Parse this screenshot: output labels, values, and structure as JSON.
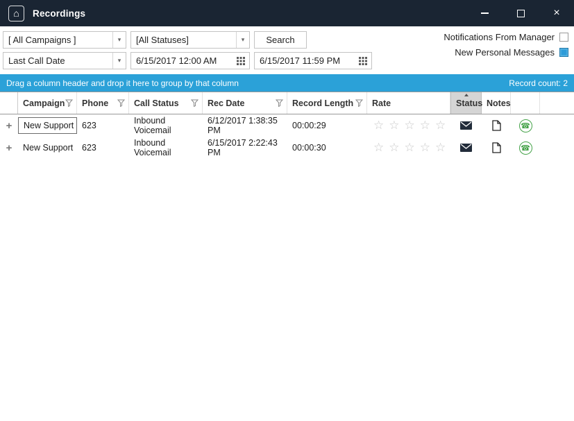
{
  "titlebar": {
    "title": "Recordings"
  },
  "toolbar": {
    "campaigns_dropdown": "[ All Campaigns ]",
    "statuses_dropdown": "[All Statuses]",
    "search_button": "Search",
    "sort_dropdown": "Last Call Date",
    "date_from": "6/15/2017 12:00 AM",
    "date_to": "6/15/2017 11:59 PM",
    "notifications_label": "Notifications From Manager",
    "notifications_checked": false,
    "messages_label": "New Personal Messages",
    "messages_checked": true
  },
  "groupbar": {
    "hint": "Drag a column header and drop it here to group by that column",
    "record_count": "Record count: 2"
  },
  "grid": {
    "columns": [
      {
        "label": "Campaign",
        "filter": true
      },
      {
        "label": "Phone",
        "filter": true
      },
      {
        "label": "Call Status",
        "filter": true
      },
      {
        "label": "Rec Date",
        "filter": true
      },
      {
        "label": "Record Length",
        "filter": true
      },
      {
        "label": "Rate",
        "filter": false
      },
      {
        "label": "Status",
        "filter": false,
        "sorted": "asc"
      },
      {
        "label": "Notes",
        "filter": false
      }
    ],
    "rows": [
      {
        "campaign": "New Support",
        "phone": "623",
        "call_status": "Inbound Voicemail",
        "rec_date": "6/12/2017 1:38:35 PM",
        "record_length": "00:00:29",
        "rating": 0
      },
      {
        "campaign": "New Support",
        "phone": "623",
        "call_status": "Inbound Voicemail",
        "rec_date": "6/15/2017 2:22:43 PM",
        "record_length": "00:00:30",
        "rating": 0
      }
    ]
  },
  "icons": {
    "home": "⌂",
    "close": "×",
    "dropdown_arrow": "▾",
    "plus": "+",
    "star": "☆",
    "phone": "☎"
  },
  "colors": {
    "titlebar": "#1a2533",
    "groupbar": "#2ba1d8",
    "accent_blue": "#2d9bd8",
    "phone_green": "#44a248",
    "sorted_header_bg": "#d5d5d5"
  }
}
